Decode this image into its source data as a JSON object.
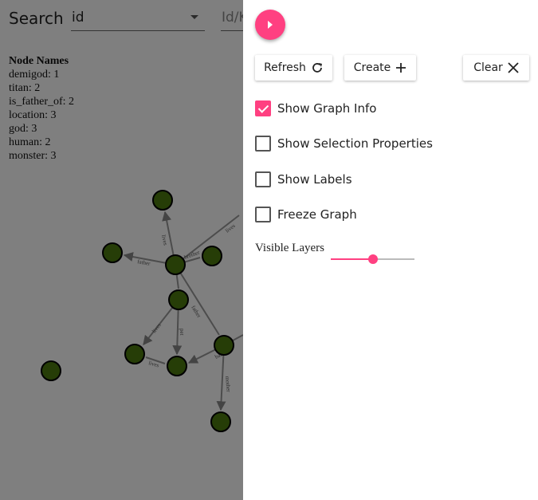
{
  "search": {
    "label": "Search",
    "field_value": "id",
    "value_placeholder": "Id/K"
  },
  "graph_info": {
    "title": "Node Names",
    "lines": [
      "demigod: 1",
      "titan: 2",
      "is_father_of: 2",
      "location: 3",
      "god: 3",
      "human: 2",
      "monster: 3"
    ]
  },
  "graph": {
    "edge_labels": [
      "lives",
      "father",
      "brother",
      "father",
      "lives",
      "lives",
      "battled",
      "mother",
      "pet",
      "lives",
      "lives"
    ]
  },
  "panel": {
    "refresh_label": "Refresh",
    "create_label": "Create",
    "clear_label": "Clear",
    "checkboxes": [
      {
        "label": "Show Graph Info",
        "checked": true
      },
      {
        "label": "Show Selection Properties",
        "checked": false
      },
      {
        "label": "Show Labels",
        "checked": false
      },
      {
        "label": "Freeze Graph",
        "checked": false
      }
    ],
    "visible_layers_label": "Visible Layers",
    "visible_layers_value": 0.5
  },
  "colors": {
    "accent": "#ff4081",
    "node": "#4c7a0f"
  }
}
